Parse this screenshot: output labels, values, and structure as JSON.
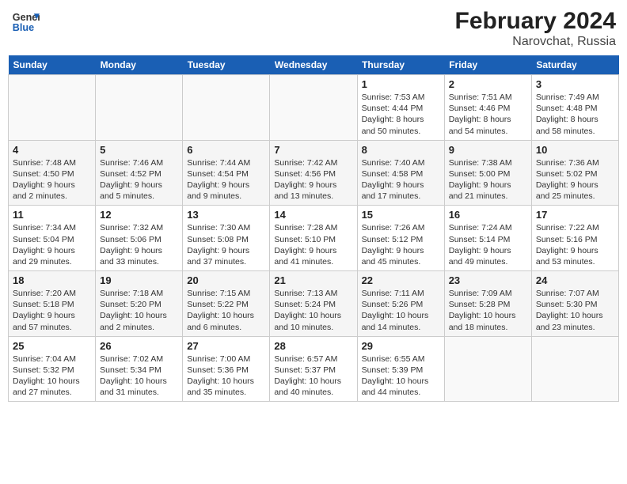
{
  "header": {
    "logo_line1": "General",
    "logo_line2": "Blue",
    "title": "February 2024",
    "subtitle": "Narovchat, Russia"
  },
  "weekdays": [
    "Sunday",
    "Monday",
    "Tuesday",
    "Wednesday",
    "Thursday",
    "Friday",
    "Saturday"
  ],
  "weeks": [
    [
      {
        "day": "",
        "info": ""
      },
      {
        "day": "",
        "info": ""
      },
      {
        "day": "",
        "info": ""
      },
      {
        "day": "",
        "info": ""
      },
      {
        "day": "1",
        "info": "Sunrise: 7:53 AM\nSunset: 4:44 PM\nDaylight: 8 hours\nand 50 minutes."
      },
      {
        "day": "2",
        "info": "Sunrise: 7:51 AM\nSunset: 4:46 PM\nDaylight: 8 hours\nand 54 minutes."
      },
      {
        "day": "3",
        "info": "Sunrise: 7:49 AM\nSunset: 4:48 PM\nDaylight: 8 hours\nand 58 minutes."
      }
    ],
    [
      {
        "day": "4",
        "info": "Sunrise: 7:48 AM\nSunset: 4:50 PM\nDaylight: 9 hours\nand 2 minutes."
      },
      {
        "day": "5",
        "info": "Sunrise: 7:46 AM\nSunset: 4:52 PM\nDaylight: 9 hours\nand 5 minutes."
      },
      {
        "day": "6",
        "info": "Sunrise: 7:44 AM\nSunset: 4:54 PM\nDaylight: 9 hours\nand 9 minutes."
      },
      {
        "day": "7",
        "info": "Sunrise: 7:42 AM\nSunset: 4:56 PM\nDaylight: 9 hours\nand 13 minutes."
      },
      {
        "day": "8",
        "info": "Sunrise: 7:40 AM\nSunset: 4:58 PM\nDaylight: 9 hours\nand 17 minutes."
      },
      {
        "day": "9",
        "info": "Sunrise: 7:38 AM\nSunset: 5:00 PM\nDaylight: 9 hours\nand 21 minutes."
      },
      {
        "day": "10",
        "info": "Sunrise: 7:36 AM\nSunset: 5:02 PM\nDaylight: 9 hours\nand 25 minutes."
      }
    ],
    [
      {
        "day": "11",
        "info": "Sunrise: 7:34 AM\nSunset: 5:04 PM\nDaylight: 9 hours\nand 29 minutes."
      },
      {
        "day": "12",
        "info": "Sunrise: 7:32 AM\nSunset: 5:06 PM\nDaylight: 9 hours\nand 33 minutes."
      },
      {
        "day": "13",
        "info": "Sunrise: 7:30 AM\nSunset: 5:08 PM\nDaylight: 9 hours\nand 37 minutes."
      },
      {
        "day": "14",
        "info": "Sunrise: 7:28 AM\nSunset: 5:10 PM\nDaylight: 9 hours\nand 41 minutes."
      },
      {
        "day": "15",
        "info": "Sunrise: 7:26 AM\nSunset: 5:12 PM\nDaylight: 9 hours\nand 45 minutes."
      },
      {
        "day": "16",
        "info": "Sunrise: 7:24 AM\nSunset: 5:14 PM\nDaylight: 9 hours\nand 49 minutes."
      },
      {
        "day": "17",
        "info": "Sunrise: 7:22 AM\nSunset: 5:16 PM\nDaylight: 9 hours\nand 53 minutes."
      }
    ],
    [
      {
        "day": "18",
        "info": "Sunrise: 7:20 AM\nSunset: 5:18 PM\nDaylight: 9 hours\nand 57 minutes."
      },
      {
        "day": "19",
        "info": "Sunrise: 7:18 AM\nSunset: 5:20 PM\nDaylight: 10 hours\nand 2 minutes."
      },
      {
        "day": "20",
        "info": "Sunrise: 7:15 AM\nSunset: 5:22 PM\nDaylight: 10 hours\nand 6 minutes."
      },
      {
        "day": "21",
        "info": "Sunrise: 7:13 AM\nSunset: 5:24 PM\nDaylight: 10 hours\nand 10 minutes."
      },
      {
        "day": "22",
        "info": "Sunrise: 7:11 AM\nSunset: 5:26 PM\nDaylight: 10 hours\nand 14 minutes."
      },
      {
        "day": "23",
        "info": "Sunrise: 7:09 AM\nSunset: 5:28 PM\nDaylight: 10 hours\nand 18 minutes."
      },
      {
        "day": "24",
        "info": "Sunrise: 7:07 AM\nSunset: 5:30 PM\nDaylight: 10 hours\nand 23 minutes."
      }
    ],
    [
      {
        "day": "25",
        "info": "Sunrise: 7:04 AM\nSunset: 5:32 PM\nDaylight: 10 hours\nand 27 minutes."
      },
      {
        "day": "26",
        "info": "Sunrise: 7:02 AM\nSunset: 5:34 PM\nDaylight: 10 hours\nand 31 minutes."
      },
      {
        "day": "27",
        "info": "Sunrise: 7:00 AM\nSunset: 5:36 PM\nDaylight: 10 hours\nand 35 minutes."
      },
      {
        "day": "28",
        "info": "Sunrise: 6:57 AM\nSunset: 5:37 PM\nDaylight: 10 hours\nand 40 minutes."
      },
      {
        "day": "29",
        "info": "Sunrise: 6:55 AM\nSunset: 5:39 PM\nDaylight: 10 hours\nand 44 minutes."
      },
      {
        "day": "",
        "info": ""
      },
      {
        "day": "",
        "info": ""
      }
    ]
  ]
}
